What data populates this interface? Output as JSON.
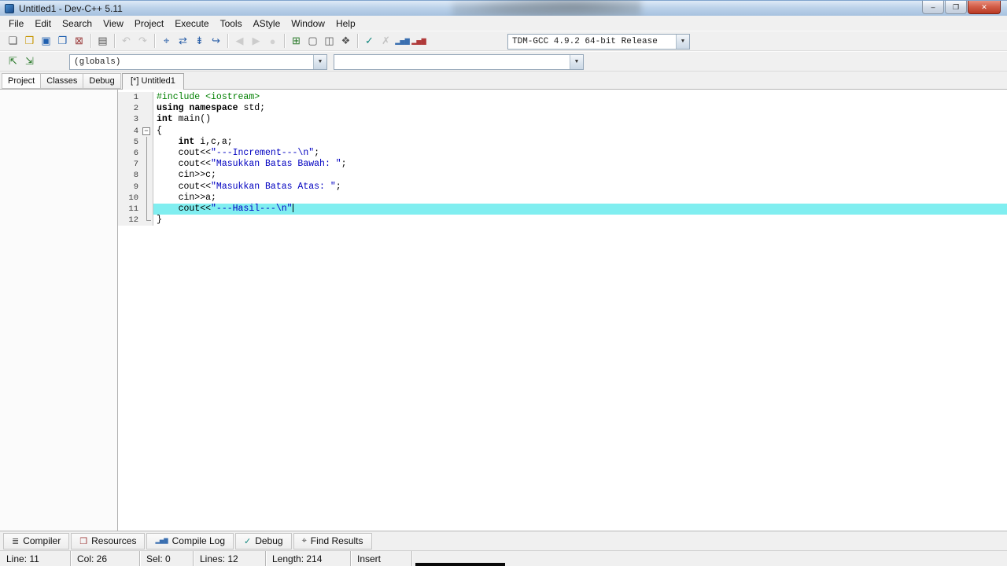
{
  "window": {
    "title": "Untitled1 - Dev-C++ 5.11",
    "minimize_label": "–",
    "maximize_label": "❐",
    "close_label": "✕"
  },
  "menu": {
    "items": [
      "File",
      "Edit",
      "Search",
      "View",
      "Project",
      "Execute",
      "Tools",
      "AStyle",
      "Window",
      "Help"
    ]
  },
  "toolbar": {
    "compiler_profile": "TDM-GCC 4.9.2 64-bit Release",
    "globals_value": "(globals)",
    "members_value": "",
    "groups": [
      [
        {
          "name": "new-source-icon",
          "glyph": "❏",
          "color": "#555555"
        },
        {
          "name": "open-file-icon",
          "glyph": "❒",
          "color": "#c79600"
        },
        {
          "name": "save-icon",
          "glyph": "▣",
          "color": "#1f5faf"
        },
        {
          "name": "save-all-icon",
          "glyph": "❐",
          "color": "#1f5faf"
        },
        {
          "name": "close-file-icon",
          "glyph": "⊠",
          "color": "#9a3a3a"
        }
      ],
      [
        {
          "name": "print-icon",
          "glyph": "▤",
          "color": "#555555"
        }
      ],
      [
        {
          "name": "undo-icon",
          "glyph": "↶",
          "color": "#a0a0a0",
          "disabled": true
        },
        {
          "name": "redo-icon",
          "glyph": "↷",
          "color": "#a0a0a0",
          "disabled": true
        }
      ],
      [
        {
          "name": "find-icon",
          "glyph": "⌖",
          "color": "#2a5fa8"
        },
        {
          "name": "replace-icon",
          "glyph": "⇄",
          "color": "#2a5fa8"
        },
        {
          "name": "find-next-icon",
          "glyph": "⇟",
          "color": "#2a5fa8"
        },
        {
          "name": "goto-line-icon",
          "glyph": "↪",
          "color": "#2a5fa8"
        }
      ],
      [
        {
          "name": "back-icon",
          "glyph": "◀",
          "color": "#b0b0b0",
          "disabled": true
        },
        {
          "name": "forward-icon",
          "glyph": "▶",
          "color": "#b0b0b0",
          "disabled": true
        },
        {
          "name": "abort-icon",
          "glyph": "●",
          "color": "#b8b8b8",
          "disabled": true
        }
      ],
      [
        {
          "name": "new-project-icon",
          "glyph": "⊞",
          "color": "#2a7a2a"
        },
        {
          "name": "project-options-icon",
          "glyph": "▢",
          "color": "#555555"
        },
        {
          "name": "insert-snippet-icon",
          "glyph": "◫",
          "color": "#555555"
        },
        {
          "name": "package-manager-icon",
          "glyph": "❖",
          "color": "#555555"
        }
      ],
      [
        {
          "name": "compile-icon",
          "glyph": "✓",
          "color": "#12867e"
        },
        {
          "name": "abort-compilation-icon",
          "glyph": "✗",
          "color": "#a0a0a0",
          "disabled": true
        },
        {
          "name": "profile-icon",
          "glyph": "▂▅▇",
          "color": "#3a6fb0"
        },
        {
          "name": "delete-profiling-icon",
          "glyph": "▂▅▇",
          "color": "#b03a3a"
        }
      ]
    ],
    "classbrowser_icons": [
      {
        "name": "goto-declaration-icon",
        "glyph": "⇱",
        "color": "#2a7a2a"
      },
      {
        "name": "goto-implementation-icon",
        "glyph": "⇲",
        "color": "#2a7a2a"
      }
    ]
  },
  "side_tabs": [
    {
      "label": "Project",
      "active": true
    },
    {
      "label": "Classes",
      "active": false
    },
    {
      "label": "Debug",
      "active": false
    }
  ],
  "editor": {
    "tab_label": "[*] Untitled1",
    "colors": {
      "preprocessor": "#007f00",
      "keyword": "#000000",
      "string": "#0000c0",
      "plain": "#000000",
      "line_highlight": "#80eef0",
      "gutter_bg": "#f0f0f0",
      "gutter_text": "#404040"
    },
    "lines": [
      {
        "n": 1,
        "segs": [
          {
            "t": "#include <iostream>",
            "c": "pp"
          }
        ]
      },
      {
        "n": 2,
        "segs": [
          {
            "t": "using",
            "c": "kw"
          },
          {
            "t": " ",
            "c": "pl"
          },
          {
            "t": "namespace",
            "c": "kw"
          },
          {
            "t": " std;",
            "c": "pl"
          }
        ]
      },
      {
        "n": 3,
        "segs": [
          {
            "t": "int",
            "c": "kw"
          },
          {
            "t": " main()",
            "c": "pl"
          }
        ]
      },
      {
        "n": 4,
        "fold": "start",
        "segs": [
          {
            "t": "{",
            "c": "pl"
          }
        ]
      },
      {
        "n": 5,
        "fold": "mid",
        "segs": [
          {
            "t": "    ",
            "c": "pl"
          },
          {
            "t": "int",
            "c": "kw"
          },
          {
            "t": " i,c,a;",
            "c": "pl"
          }
        ]
      },
      {
        "n": 6,
        "fold": "mid",
        "segs": [
          {
            "t": "    cout<<",
            "c": "pl"
          },
          {
            "t": "\"---Increment---\\n\"",
            "c": "st"
          },
          {
            "t": ";",
            "c": "pl"
          }
        ]
      },
      {
        "n": 7,
        "fold": "mid",
        "segs": [
          {
            "t": "    cout<<",
            "c": "pl"
          },
          {
            "t": "\"Masukkan Batas Bawah: \"",
            "c": "st"
          },
          {
            "t": ";",
            "c": "pl"
          }
        ]
      },
      {
        "n": 8,
        "fold": "mid",
        "segs": [
          {
            "t": "    cin>>c;",
            "c": "pl"
          }
        ]
      },
      {
        "n": 9,
        "fold": "mid",
        "segs": [
          {
            "t": "    cout<<",
            "c": "pl"
          },
          {
            "t": "\"Masukkan Batas Atas: \"",
            "c": "st"
          },
          {
            "t": ";",
            "c": "pl"
          }
        ]
      },
      {
        "n": 10,
        "fold": "mid",
        "segs": [
          {
            "t": "    cin>>a;",
            "c": "pl"
          }
        ]
      },
      {
        "n": 11,
        "fold": "mid",
        "highlight": true,
        "caret": true,
        "segs": [
          {
            "t": "    cout<<",
            "c": "pl"
          },
          {
            "t": "\"---Hasil---\\n\"",
            "c": "st"
          }
        ]
      },
      {
        "n": 12,
        "fold": "end",
        "segs": [
          {
            "t": "}",
            "c": "pl"
          }
        ]
      }
    ]
  },
  "bottom_tabs": [
    {
      "label": "Compiler",
      "icon": "compiler-icon",
      "glyph": "≣",
      "color": "#555555"
    },
    {
      "label": "Resources",
      "icon": "resources-icon",
      "glyph": "❒",
      "color": "#a04040"
    },
    {
      "label": "Compile Log",
      "icon": "compile-log-icon",
      "glyph": "▂▅▇",
      "color": "#3a6fb0"
    },
    {
      "label": "Debug",
      "icon": "debug-icon",
      "glyph": "✓",
      "color": "#12867e"
    },
    {
      "label": "Find Results",
      "icon": "find-results-icon",
      "glyph": "⌖",
      "color": "#555555"
    }
  ],
  "status_bar": {
    "segments": [
      "Line: 11",
      "Col: 26",
      "Sel: 0",
      "Lines: 12",
      "Length: 214",
      "Insert"
    ]
  }
}
